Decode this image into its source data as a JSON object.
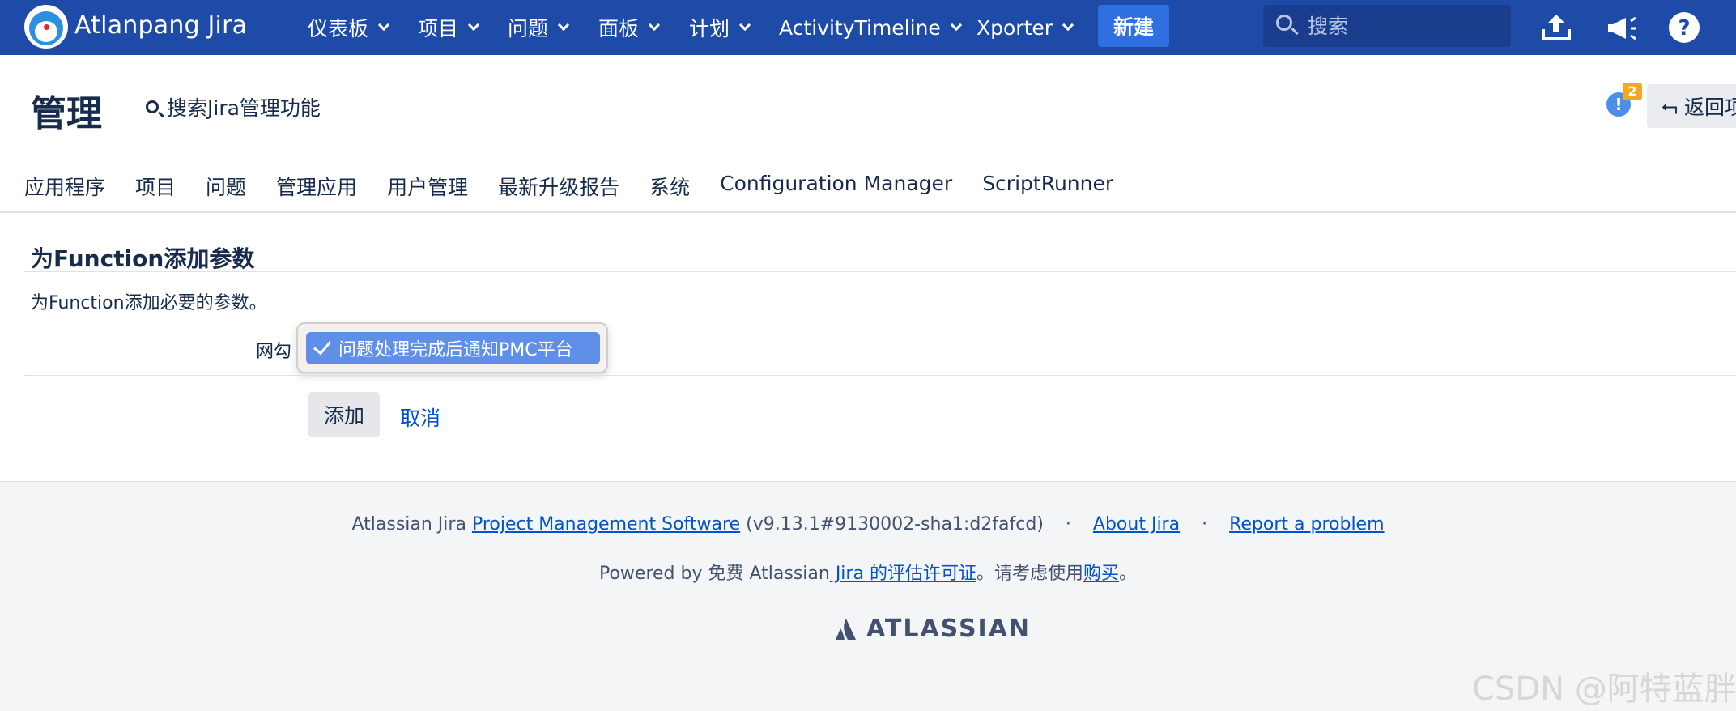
{
  "topnav": {
    "brand": "Atlanpang Jira",
    "menus": [
      {
        "label": "仪表板"
      },
      {
        "label": "项目"
      },
      {
        "label": "问题"
      },
      {
        "label": "面板"
      },
      {
        "label": "计划"
      },
      {
        "label": "ActivityTimeline"
      },
      {
        "label": "Xporter"
      }
    ],
    "create_label": "新建",
    "search_placeholder": "搜索",
    "icons": [
      "upload-icon",
      "megaphone-icon",
      "help-icon"
    ],
    "color": "#1e4aa8"
  },
  "admin": {
    "title": "管理",
    "search_label": "搜索Jira管理功能",
    "notification_count": "2",
    "back_label": "返回项"
  },
  "tabs": [
    "应用程序",
    "项目",
    "问题",
    "管理应用",
    "用户管理",
    "最新升级报告",
    "系统",
    "Configuration Manager",
    "ScriptRunner"
  ],
  "form": {
    "heading": "为Function添加参数",
    "description": "为Function添加必要的参数。",
    "field_label": "网勾",
    "selected_option": "问题处理完成后通知PMC平台",
    "add_label": "添加",
    "cancel_label": "取消"
  },
  "footer": {
    "line1_prefix": "Atlassian Jira",
    "line1_link": "Project Management Software",
    "line1_version": "(v9.13.1#9130002-sha1:d2fafcd)",
    "about_link": "About Jira",
    "report_link": "Report a problem",
    "line2_prefix": "Powered by 免费 Atlassian",
    "line2_link": " Jira 的评估许可证",
    "line2_mid": "。请考虑使用",
    "line2_buy": "购买",
    "line2_end": "。",
    "logo_text": "ATLASSIAN"
  },
  "watermark": "CSDN @阿特蓝胖"
}
